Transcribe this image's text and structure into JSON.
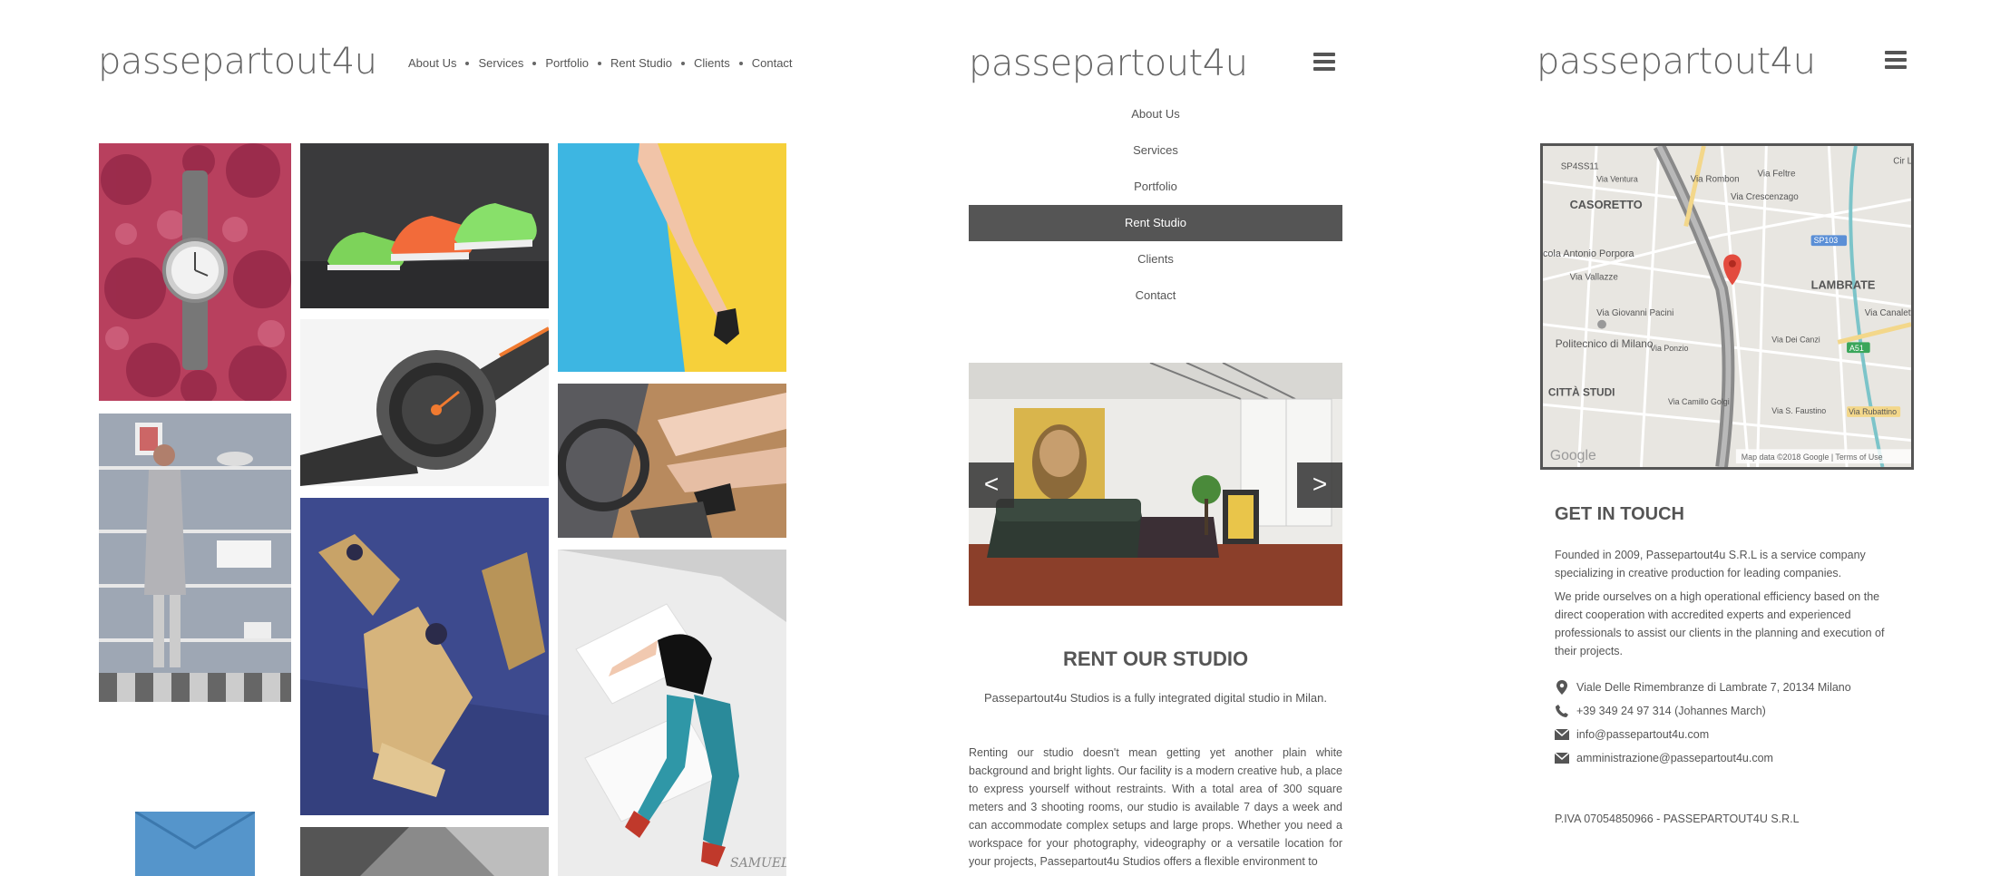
{
  "brand": {
    "logo_text": "passepartout4u"
  },
  "left_panel": {
    "nav": [
      "About Us",
      "Services",
      "Portfolio",
      "Rent Studio",
      "Clients",
      "Contact"
    ],
    "watermark": "SAMUELE"
  },
  "middle_panel": {
    "menu": [
      {
        "label": "About Us",
        "active": false
      },
      {
        "label": "Services",
        "active": false
      },
      {
        "label": "Portfolio",
        "active": false
      },
      {
        "label": "Rent Studio",
        "active": true
      },
      {
        "label": "Clients",
        "active": false
      },
      {
        "label": "Contact",
        "active": false
      }
    ],
    "slider": {
      "prev_label": "<",
      "next_label": ">"
    },
    "title": "RENT OUR STUDIO",
    "subtitle": "Passepartout4u Studios is a fully integrated digital studio in Milan.",
    "body": "Renting our studio doesn't mean getting yet another plain white background and bright lights. Our facility is a modern creative hub, a place to express yourself without restraints. With a total area of 300 square meters and 3 shooting rooms, our studio is available 7 days a week and can accommodate complex setups and large props. Whether you need a workspace for your photography, videography or a versatile location for your projects, Passepartout4u Studios offers a flexible environment to"
  },
  "right_panel": {
    "map": {
      "labels": [
        "CASORETTO",
        "LAMBRATE",
        "Politecnico di Milano",
        "CITTÀ STUDI",
        "cola Antonio Porpora",
        "Via Vallazze",
        "Via Giovanni Pacini",
        "Via Feltre",
        "Via Crescenzago",
        "Via Rombon",
        "Via Rubattino",
        "Via Canaletto",
        "SP103",
        "A51",
        "SP4SS11",
        "Via Ventura",
        "Via Ponzio",
        "Via Dei Canzi",
        "Via Camillo Golgi",
        "Via S. Faustino",
        "Cir La"
      ],
      "footer": "Map data ©2018 Google | Terms of Use",
      "google": "Google"
    },
    "title": "GET IN TOUCH",
    "paragraph1": "Founded in 2009, Passepartout4u S.R.L is a service company specializing in creative production for leading companies.",
    "paragraph2": "We pride ourselves on a high operational efficiency based on the direct cooperation with accredited experts and experienced professionals to assist our clients in the planning and execution of their projects.",
    "address": "Viale Delle Rimembranze di Lambrate 7, 20134 Milano",
    "phone": "+39 349 24 97 314 (Johannes March)",
    "email1": "info@passepartout4u.com",
    "email2": "amministrazione@passepartout4u.com",
    "piva": "P.IVA 07054850966 - PASSEPARTOUT4U S.R.L",
    "icons": [
      "map-pin-icon",
      "phone-icon",
      "mail-icon",
      "mail-icon"
    ]
  }
}
